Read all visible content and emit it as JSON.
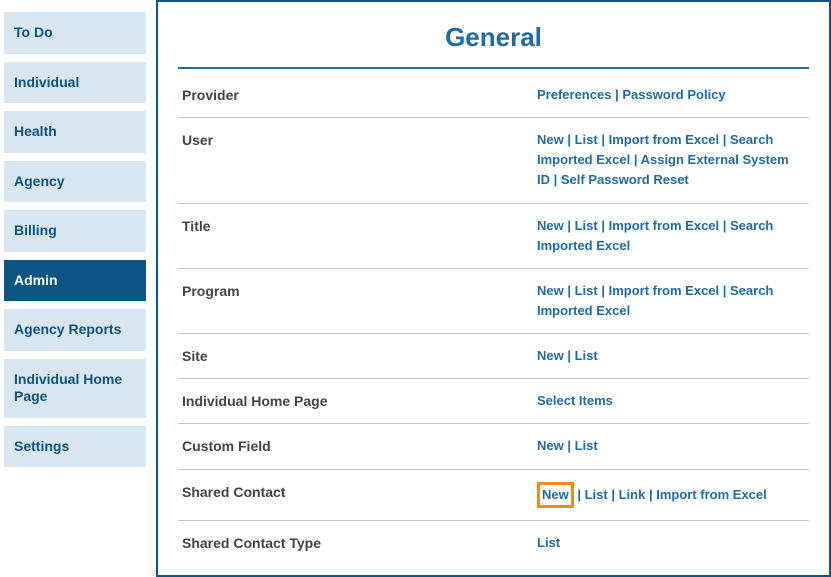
{
  "sidebar": {
    "items": [
      {
        "id": "todo",
        "label": "To Do",
        "active": false
      },
      {
        "id": "individual",
        "label": "Individual",
        "active": false
      },
      {
        "id": "health",
        "label": "Health",
        "active": false
      },
      {
        "id": "agency",
        "label": "Agency",
        "active": false
      },
      {
        "id": "billing",
        "label": "Billing",
        "active": false
      },
      {
        "id": "admin",
        "label": "Admin",
        "active": true
      },
      {
        "id": "agency-reports",
        "label": "Agency Reports",
        "active": false
      },
      {
        "id": "individual-home-page",
        "label": "Individual Home Page",
        "active": false
      },
      {
        "id": "settings",
        "label": "Settings",
        "active": false
      }
    ]
  },
  "main": {
    "title": "General",
    "rows": [
      {
        "id": "provider",
        "label": "Provider",
        "actions": [
          {
            "id": "preferences",
            "label": "Preferences"
          },
          {
            "id": "password-policy",
            "label": "Password Policy"
          }
        ]
      },
      {
        "id": "user",
        "label": "User",
        "actions": [
          {
            "id": "new",
            "label": "New"
          },
          {
            "id": "list",
            "label": "List"
          },
          {
            "id": "import-excel",
            "label": "Import from Excel"
          },
          {
            "id": "search-imported",
            "label": "Search Imported Excel"
          },
          {
            "id": "assign-external",
            "label": "Assign External System ID"
          },
          {
            "id": "self-password-reset",
            "label": "Self Password Reset"
          }
        ]
      },
      {
        "id": "title",
        "label": "Title",
        "actions": [
          {
            "id": "new",
            "label": "New"
          },
          {
            "id": "list",
            "label": "List"
          },
          {
            "id": "import-excel",
            "label": "Import from Excel"
          },
          {
            "id": "search-imported",
            "label": "Search Imported Excel"
          }
        ]
      },
      {
        "id": "program",
        "label": "Program",
        "actions": [
          {
            "id": "new",
            "label": "New"
          },
          {
            "id": "list",
            "label": "List"
          },
          {
            "id": "import-excel",
            "label": "Import from Excel"
          },
          {
            "id": "search-imported",
            "label": "Search Imported Excel"
          }
        ]
      },
      {
        "id": "site",
        "label": "Site",
        "actions": [
          {
            "id": "new",
            "label": "New"
          },
          {
            "id": "list",
            "label": "List"
          }
        ]
      },
      {
        "id": "individual-home-page",
        "label": "Individual Home Page",
        "actions": [
          {
            "id": "select-items",
            "label": "Select Items"
          }
        ]
      },
      {
        "id": "custom-field",
        "label": "Custom Field",
        "actions": [
          {
            "id": "new",
            "label": "New"
          },
          {
            "id": "list",
            "label": "List"
          }
        ]
      },
      {
        "id": "shared-contact",
        "label": "Shared Contact",
        "actions": [
          {
            "id": "new",
            "label": "New",
            "highlighted": true
          },
          {
            "id": "list",
            "label": "List"
          },
          {
            "id": "link",
            "label": "Link"
          },
          {
            "id": "import-excel",
            "label": "Import from Excel"
          }
        ]
      },
      {
        "id": "shared-contact-type",
        "label": "Shared Contact Type",
        "actions": [
          {
            "id": "list",
            "label": "List"
          }
        ]
      }
    ]
  }
}
